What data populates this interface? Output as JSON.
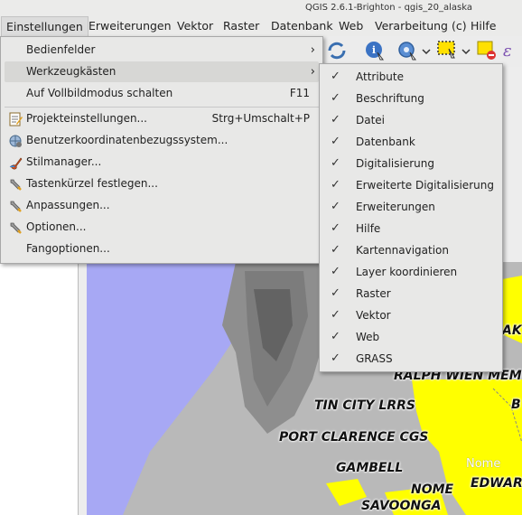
{
  "window": {
    "title": "QGIS 2.6.1-Brighton - qgis_20_alaska"
  },
  "menubar": {
    "items": [
      {
        "label": "Einstellungen"
      },
      {
        "label": "Erweiterungen"
      },
      {
        "label": "Vektor"
      },
      {
        "label": "Raster"
      },
      {
        "label": "Datenbank"
      },
      {
        "label": "Web"
      },
      {
        "label": "Verarbeitung (c)"
      },
      {
        "label": "Hilfe"
      }
    ]
  },
  "settings_menu": {
    "items": [
      {
        "label": "Bedienfelder",
        "shortcut": "",
        "submenu": true
      },
      {
        "label": "Werkzeugkästen",
        "shortcut": "",
        "submenu": true
      },
      {
        "label": "Auf Vollbildmodus schalten",
        "shortcut": "F11"
      },
      {
        "label": "Projekteinstellungen...",
        "shortcut": "Strg+Umschalt+P",
        "icon": "document-edit-icon"
      },
      {
        "label": "Benutzerkoordinatenbezugssystem...",
        "shortcut": "",
        "icon": "crs-globe-icon"
      },
      {
        "label": "Stilmanager...",
        "shortcut": "",
        "icon": "paintbrush-icon"
      },
      {
        "label": "Tastenkürzel festlegen...",
        "shortcut": "",
        "icon": "wrench-icon"
      },
      {
        "label": "Anpassungen...",
        "shortcut": "",
        "icon": "wrench-icon"
      },
      {
        "label": "Optionen...",
        "shortcut": "",
        "icon": "wrench-icon"
      },
      {
        "label": "Fangoptionen...",
        "shortcut": ""
      }
    ]
  },
  "toolbox_submenu": {
    "items": [
      {
        "label": "Attribute",
        "checked": true
      },
      {
        "label": "Beschriftung",
        "checked": true
      },
      {
        "label": "Datei",
        "checked": true
      },
      {
        "label": "Datenbank",
        "checked": true
      },
      {
        "label": "Digitalisierung",
        "checked": true
      },
      {
        "label": "Erweiterte Digitalisierung",
        "checked": true
      },
      {
        "label": "Erweiterungen",
        "checked": true
      },
      {
        "label": "Hilfe",
        "checked": true
      },
      {
        "label": "Kartennavigation",
        "checked": true
      },
      {
        "label": "Layer koordinieren",
        "checked": true
      },
      {
        "label": "Raster",
        "checked": true
      },
      {
        "label": "Vektor",
        "checked": true
      },
      {
        "label": "Web",
        "checked": true
      },
      {
        "label": "GRASS",
        "checked": true
      }
    ]
  },
  "map_labels": {
    "ralph": "RALPH WIEN MEM",
    "tin_city": "TIN CITY LRRS",
    "port_clarence": "PORT CLARENCE CGS",
    "gambell": "GAMBELL",
    "nome_upper": "NOME",
    "edward": "EDWAR",
    "savoonga": "SAVOONGA",
    "nome_lower": "Nome",
    "ak": "AK",
    "b": "B"
  },
  "colors": {
    "sea": "#a7a8f4",
    "land": "#b8b8b8",
    "highlight_region": "#ffff00"
  }
}
